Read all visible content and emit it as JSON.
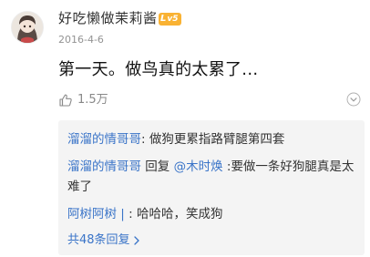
{
  "comment": {
    "username": "好吃懒做茉莉酱",
    "level_badge": {
      "prefix": "L",
      "text": "v5",
      "color": "#f9b233"
    },
    "date": "2016-4-6",
    "content": "第一天。做鸟真的太累了...",
    "like_count": "1.5万",
    "icons": {
      "like": "thumbs-up-icon",
      "more": "chevron-down-icon"
    }
  },
  "replies": [
    {
      "author": "溜溜的情哥哥",
      "separator": ": ",
      "text": "做狗更累指路臂腿第四套"
    },
    {
      "author": "溜溜的情哥哥",
      "reply_word": " 回复 ",
      "mention": "@木时焕",
      "separator": " :",
      "text": "要做一条好狗腿真是太难了"
    },
    {
      "author": "阿树阿树",
      "badge": " | ",
      "separator": ": ",
      "text": "哈哈哈，笑成狗"
    }
  ],
  "more_replies": {
    "label": "共48条回复",
    "icon": "chevron-right-icon"
  },
  "colors": {
    "link_blue": "#3a74c8",
    "text": "#333333",
    "meta": "#939393",
    "reply_bg": "#f4f4f4"
  }
}
